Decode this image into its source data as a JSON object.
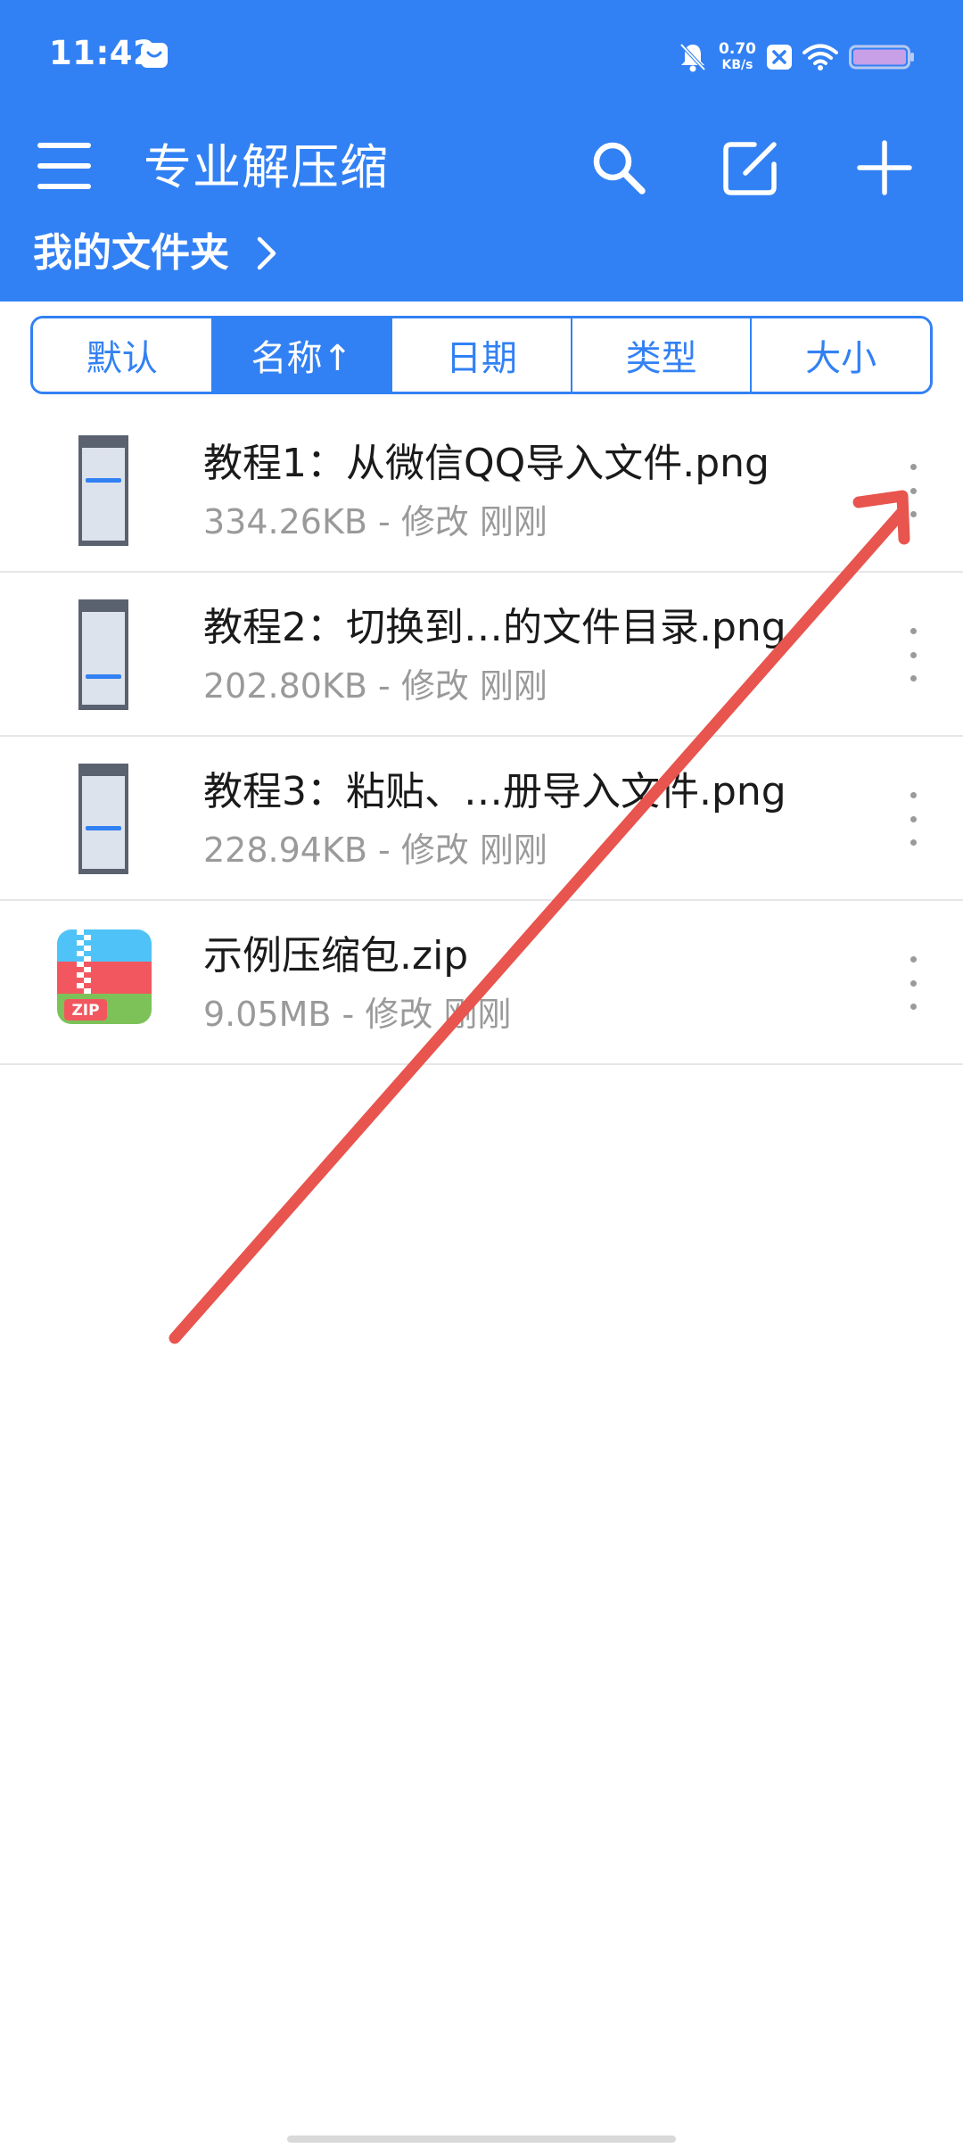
{
  "status_bar": {
    "time": "11:42",
    "net_speed_value": "0.70",
    "net_speed_unit": "KB/s",
    "icons": [
      "message-icon",
      "bell-mute-icon",
      "close-app-icon",
      "wifi-icon",
      "battery-icon"
    ]
  },
  "app_bar": {
    "title": "专业解压缩",
    "icons": [
      "menu-icon",
      "search-icon",
      "edit-icon",
      "add-icon"
    ]
  },
  "breadcrumb": {
    "label": "我的文件夹"
  },
  "sort_tabs": [
    {
      "label": "默认",
      "active": false
    },
    {
      "label": "名称↑",
      "active": true
    },
    {
      "label": "日期",
      "active": false
    },
    {
      "label": "类型",
      "active": false
    },
    {
      "label": "大小",
      "active": false
    }
  ],
  "files": [
    {
      "name": "教程1：从微信QQ导入文件.png",
      "meta": "334.26KB - 修改 刚刚",
      "type": "image"
    },
    {
      "name": "教程2：切换到…的文件目录.png",
      "meta": "202.80KB - 修改 刚刚",
      "type": "image"
    },
    {
      "name": "教程3：粘贴、…册导入文件.png",
      "meta": "228.94KB - 修改 刚刚",
      "type": "image"
    },
    {
      "name": "示例压缩包.zip",
      "meta": "9.05MB - 修改 刚刚",
      "type": "zip"
    }
  ],
  "zip_badge": "ZIP",
  "colors": {
    "primary": "#3281F4",
    "annotation_arrow": "#E8544E",
    "secondary_text": "#9a9a9a"
  }
}
